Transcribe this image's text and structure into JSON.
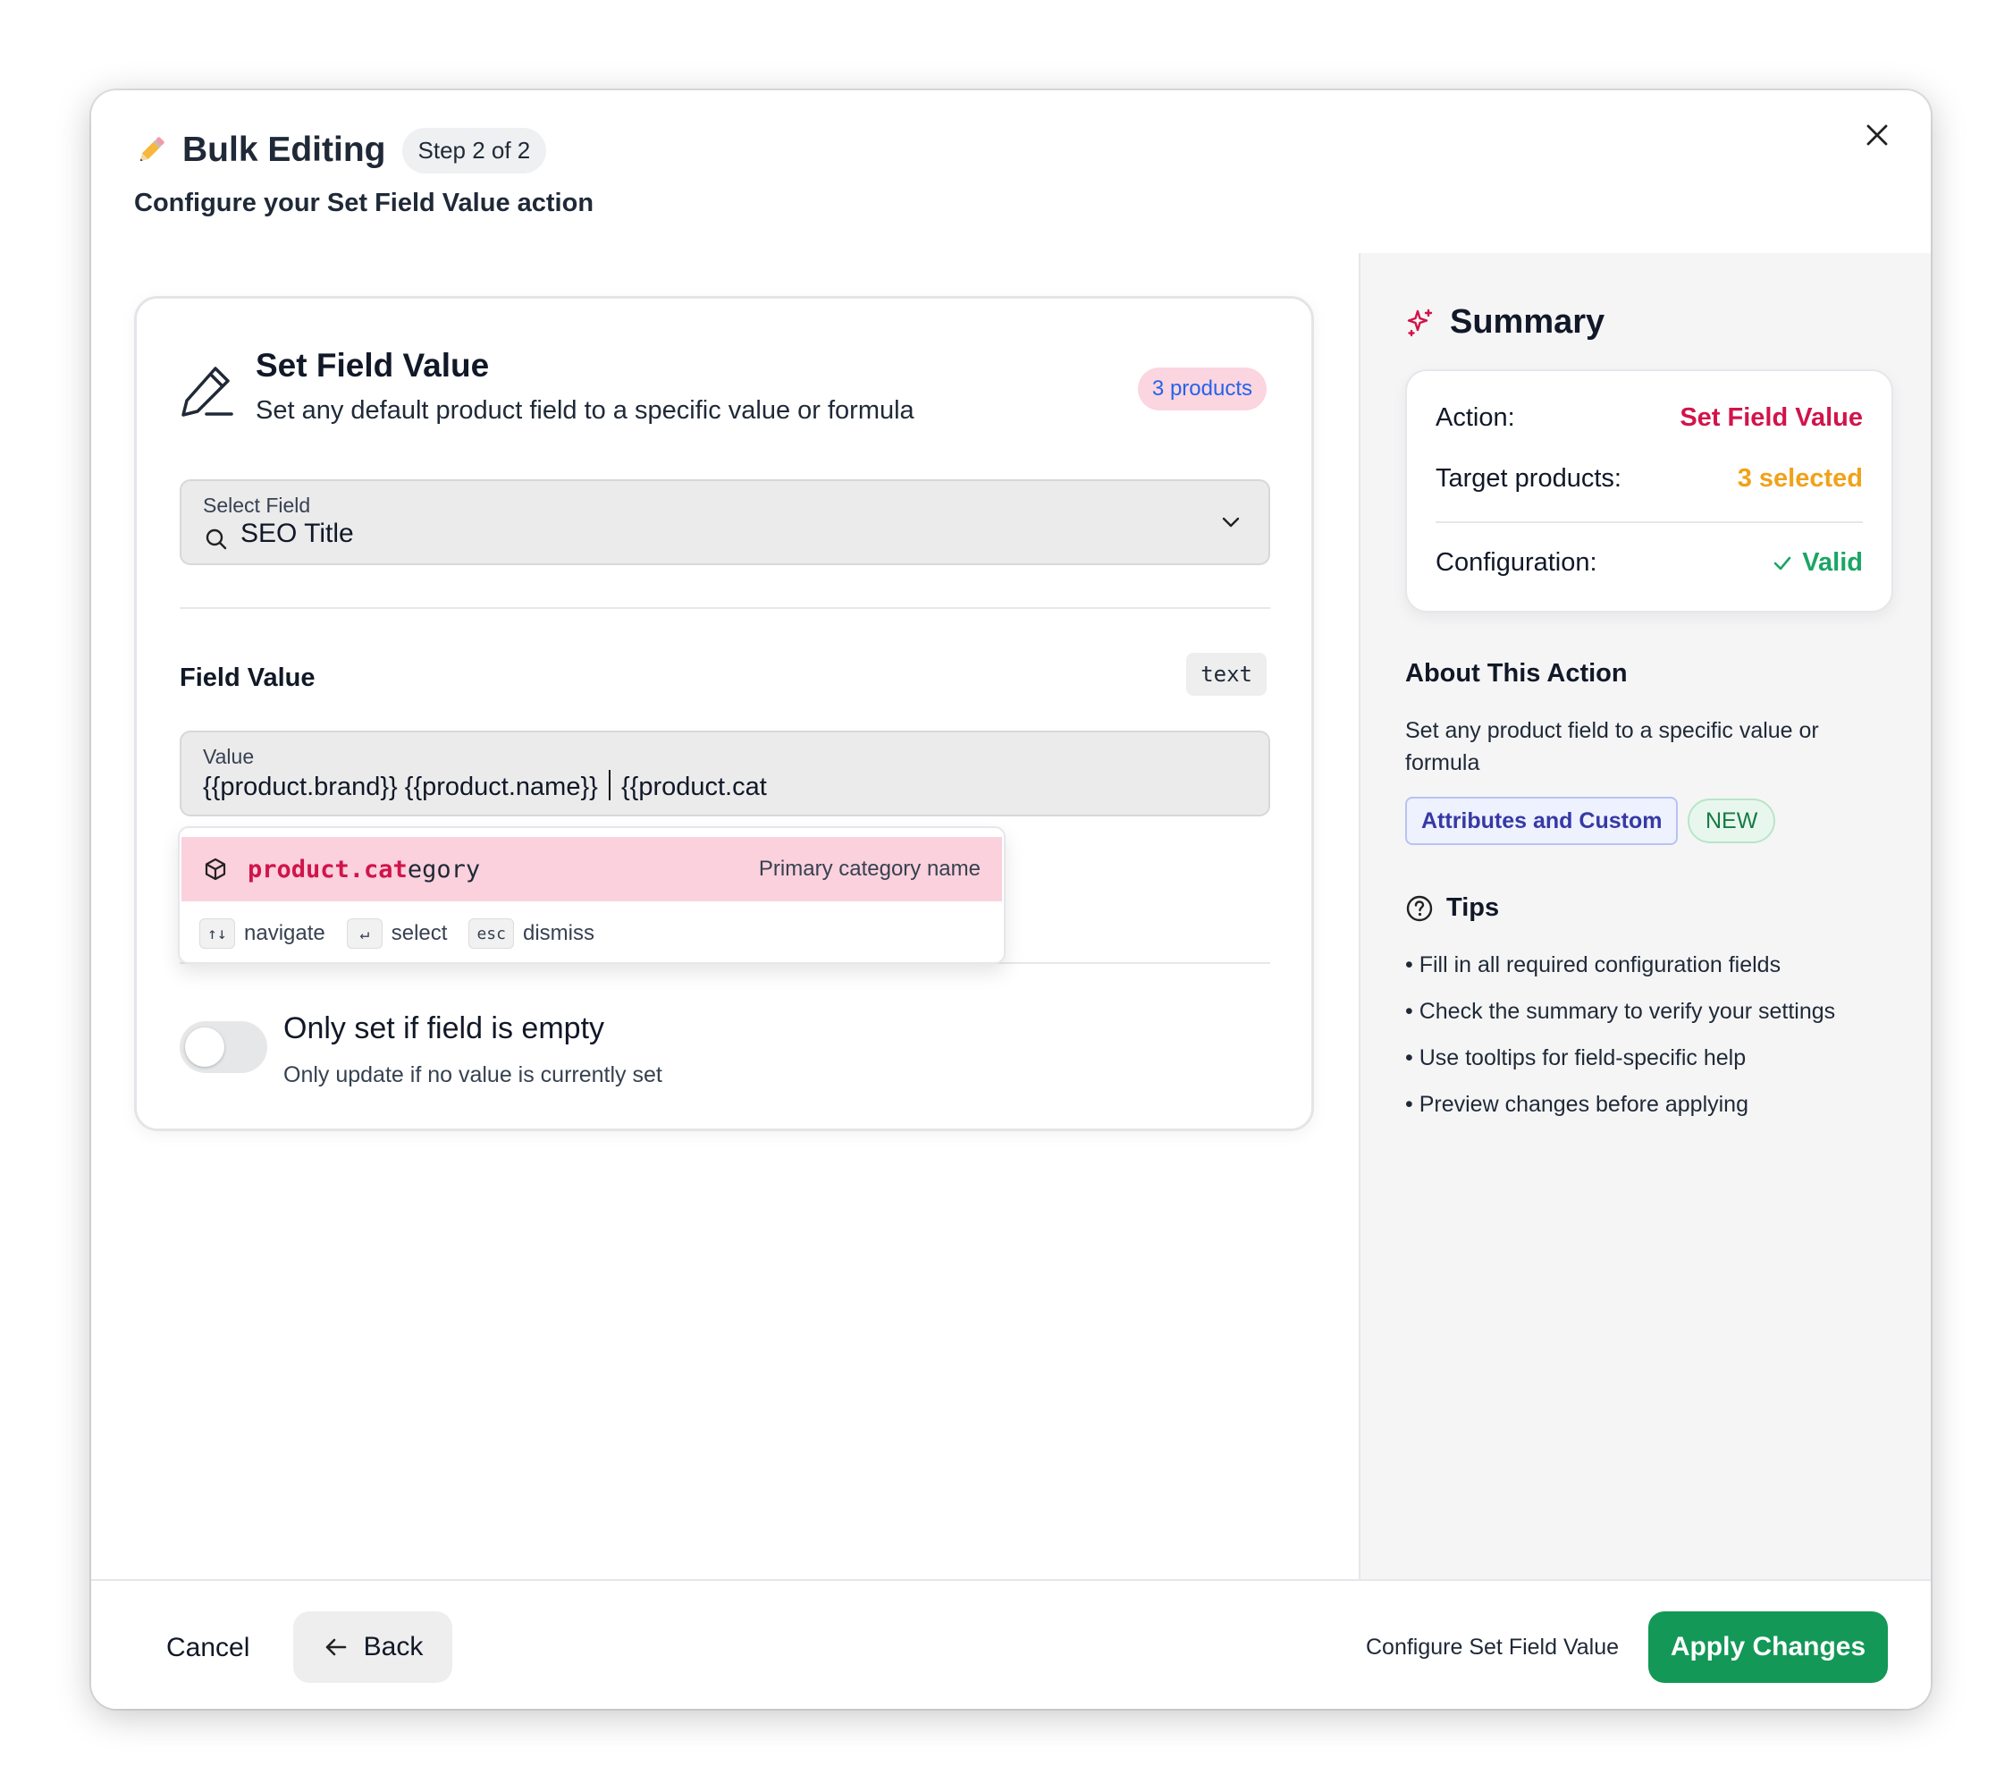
{
  "header": {
    "emoji": "✏️",
    "title": "Bulk Editing",
    "step": "Step 2 of 2",
    "subtitle_prefix": "Configure your ",
    "subtitle_action": "Set Field Value",
    "subtitle_suffix": " action"
  },
  "card": {
    "title": "Set Field Value",
    "description": "Set any default product field to a specific value or formula",
    "products_badge": "3 products",
    "select_field": {
      "label": "Select Field",
      "value": "SEO Title"
    },
    "field_value": {
      "label": "Field Value",
      "type": "text",
      "input_label": "Value",
      "input_before_caret": "{{product.brand}} {{product.name}} ",
      "input_after_caret": " {{product.cat"
    },
    "autocomplete": {
      "match": "product.cat",
      "rest": "egory",
      "description": "Primary category name",
      "hints": [
        {
          "key": "↑↓",
          "label": "navigate"
        },
        {
          "key": "↵",
          "label": "select"
        },
        {
          "key": "esc",
          "label": "dismiss"
        }
      ]
    },
    "option": {
      "title": "Only set if field is empty",
      "description": "Only update if no value is currently set",
      "enabled": false
    }
  },
  "summary": {
    "title": "Summary",
    "rows": [
      {
        "key": "Action:",
        "value": "Set Field Value"
      },
      {
        "key": "Target products:",
        "value": "3 selected"
      },
      {
        "key": "Configuration:",
        "value": "Valid"
      }
    ],
    "about_title": "About This Action",
    "about_desc": "Set any product field to a specific value or formula",
    "tag_attr": "Attributes and Custom",
    "tag_new": "NEW",
    "tips_title": "Tips",
    "tips": [
      "Fill in all required configuration fields",
      "Check the summary to verify your settings",
      "Use tooltips for field-specific help",
      "Preview changes before applying"
    ]
  },
  "footer": {
    "cancel": "Cancel",
    "back": "Back",
    "note": "Configure Set Field Value",
    "apply": "Apply Changes"
  },
  "colors": {
    "accent_red": "#d1144b",
    "orange": "#f0a21a",
    "green": "#139857",
    "badge_pink": "#fbd5df"
  }
}
